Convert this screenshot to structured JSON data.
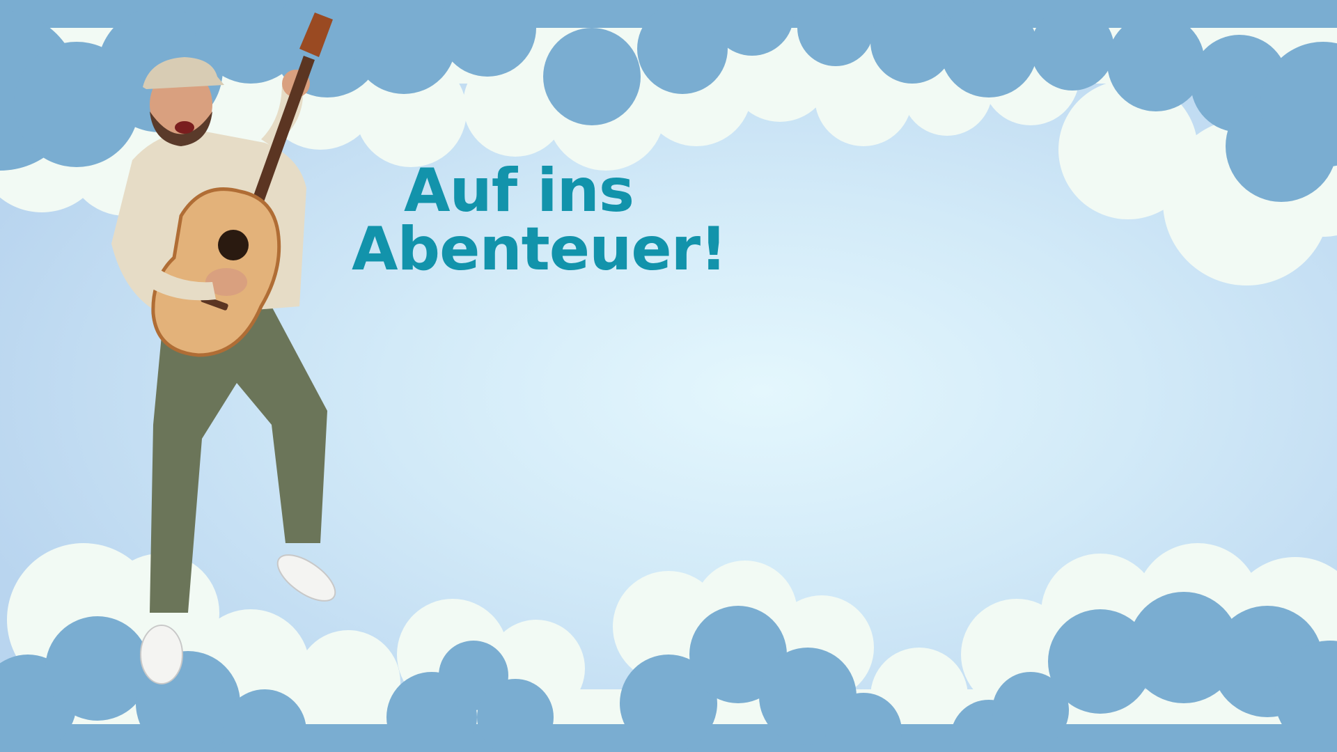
{
  "headline": {
    "line1": "Auf ins",
    "line2": "Abenteuer!",
    "color": "#1293ab"
  },
  "colors": {
    "sky_center": "#e4f7fd",
    "sky_edge": "#b9d5ef",
    "cloud_dark": "#7aadd1",
    "cloud_light": "#f2faf4"
  },
  "figure": {
    "description_icon": "guitar-player-figure"
  }
}
